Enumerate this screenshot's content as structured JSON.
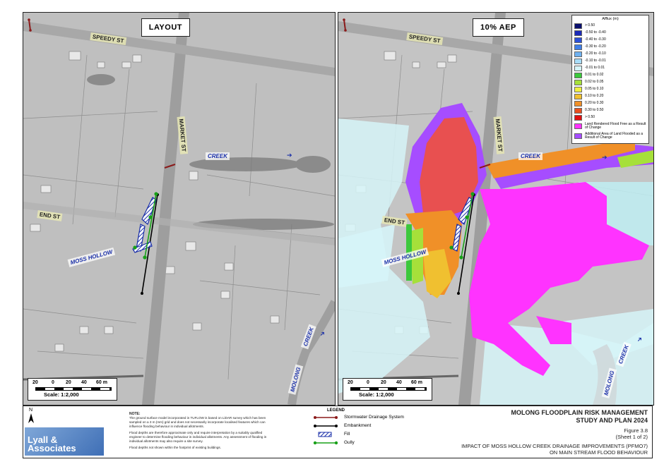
{
  "maps": {
    "left": {
      "title": "LAYOUT"
    },
    "right": {
      "title": "10% AEP"
    }
  },
  "labels": {
    "speedy_st": "SPEEDY ST",
    "market_st": "MARKET ST",
    "end_st": "END ST",
    "creek": "CREEK",
    "moss_hollow": "MOSS HOLLOW",
    "molong_creek_1": "MOLONG",
    "molong_creek_2": "CREEK"
  },
  "scalebar": {
    "ticks": [
      "20",
      "0",
      "20",
      "40",
      "60 m"
    ],
    "scale": "Scale: 1:2,000"
  },
  "afflux_legend": {
    "title": "Afflux (m)",
    "items": [
      {
        "label": "> 0.50",
        "color": "#0a0f6e"
      },
      {
        "label": "-0.50 to -0.40",
        "color": "#1b2ab8"
      },
      {
        "label": "-0.40 to -0.30",
        "color": "#2b50d8"
      },
      {
        "label": "-0.30 to -0.20",
        "color": "#3f7fe8"
      },
      {
        "label": "-0.20 to -0.10",
        "color": "#6fb1f0"
      },
      {
        "label": "-0.10 to -0.01",
        "color": "#a8dcf8"
      },
      {
        "label": "-0.01 to 0.01",
        "color": "#d6f4f8"
      },
      {
        "label": "0.01 to 0.02",
        "color": "#3cc83c"
      },
      {
        "label": "0.02 to 0.05",
        "color": "#a6e03a"
      },
      {
        "label": "0.05 to 0.10",
        "color": "#f0f040"
      },
      {
        "label": "0.10 to 0.20",
        "color": "#f0c030"
      },
      {
        "label": "0.20 to 0.30",
        "color": "#f09028"
      },
      {
        "label": "0.30 to 0.50",
        "color": "#e85020"
      },
      {
        "label": "> 0.50",
        "color": "#e01010"
      },
      {
        "label": "Land Rendered Flood Free as a Result of Change",
        "color": "#ff33ff"
      },
      {
        "label": "Additional Area of Land Flooded as a Result of Change",
        "color": "#a64dff"
      }
    ]
  },
  "footer": {
    "north": "N",
    "logo": "Lyall & Associates",
    "note_title": "NOTE:",
    "note_1": "The ground surface model incorporated in TUFLOW is based on LiDAR survey which has been sampled on a 3 m (mm) grid and does not necessarily incorporate localised features which can influence flooding behaviour in individual allotments.",
    "note_2": "Flood depths are therefore approximate only and require interpretation by a suitably qualified engineer to determine flooding behaviour in individual allotments. Any assessment of flooding in individual allotments may also require a site survey.",
    "note_3": "Flood depths not shown within the footprint of existing buildings.",
    "legend_title": "LEGEND",
    "legend_items": [
      {
        "label": "Stormwater Drainage System"
      },
      {
        "label": "Embankment"
      },
      {
        "label": "Fill"
      },
      {
        "label": "Gully"
      }
    ],
    "title_1": "MOLONG FLOODPLAIN RISK MANAGEMENT",
    "title_2": "STUDY AND PLAN 2024",
    "figure": "Figure 3.8",
    "sheet": "(Sheet 1 of 2)",
    "caption_1": "IMPACT OF MOSS HOLLOW CREEK DRAINAGE IMPROVEMENTS (PFMO7)",
    "caption_2": "ON MAIN STREAM FLOOD BEHAVIOUR"
  }
}
